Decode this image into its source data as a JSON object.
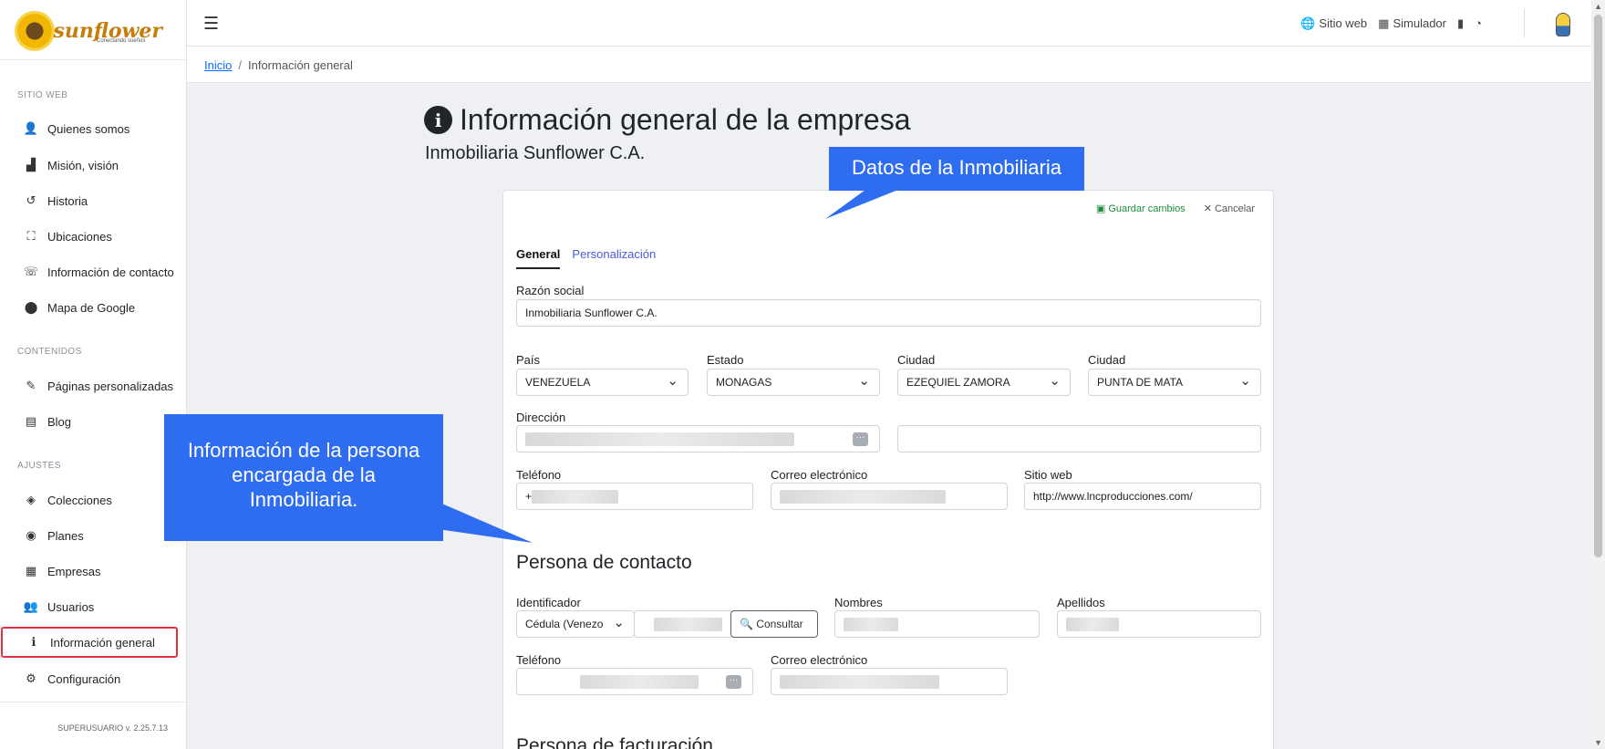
{
  "brand": {
    "name": "sunflower",
    "tagline": "Conectando sueños"
  },
  "sidebar": {
    "sections": [
      {
        "title": "SITIO WEB"
      },
      {
        "title": "CONTENIDOS"
      },
      {
        "title": "AJUSTES"
      }
    ],
    "items": [
      {
        "label": "Quienes somos",
        "icon": "user-icon"
      },
      {
        "label": "Misión, visión",
        "icon": "chart-icon"
      },
      {
        "label": "Historia",
        "icon": "history-icon"
      },
      {
        "label": "Ubicaciones",
        "icon": "map-location-icon"
      },
      {
        "label": "Información de contacto",
        "icon": "phone-icon"
      },
      {
        "label": "Mapa de Google",
        "icon": "map-pin-icon"
      },
      {
        "label": "Páginas personalizadas",
        "icon": "edit-page-icon"
      },
      {
        "label": "Blog",
        "icon": "newspaper-icon"
      },
      {
        "label": "Colecciones",
        "icon": "layers-icon"
      },
      {
        "label": "Planes",
        "icon": "user-badge-icon"
      },
      {
        "label": "Empresas",
        "icon": "buildings-icon"
      },
      {
        "label": "Usuarios",
        "icon": "users-icon"
      },
      {
        "label": "Información general",
        "icon": "info-icon"
      },
      {
        "label": "Configuración",
        "icon": "gear-icon"
      }
    ],
    "version": "SUPERUSUARIO v. 2.25.7.13"
  },
  "topbar": {
    "sitio_web": "Sitio web",
    "simulador": "Simulador"
  },
  "breadcrumb": {
    "home": "Inicio",
    "current": "Información general"
  },
  "page": {
    "title": "Información general de la empresa",
    "subtitle": "Inmobiliaria Sunflower C.A."
  },
  "card": {
    "save_label": "Guardar cambios",
    "cancel_label": "Cancelar",
    "tabs": [
      "General",
      "Personalización"
    ],
    "razon_social": {
      "label": "Razón social",
      "value": "Inmobiliaria Sunflower C.A."
    },
    "pais": {
      "label": "País",
      "value": "VENEZUELA"
    },
    "estado": {
      "label": "Estado",
      "value": "MONAGAS"
    },
    "ciudad1": {
      "label": "Ciudad",
      "value": "EZEQUIEL ZAMORA"
    },
    "ciudad2": {
      "label": "Ciudad",
      "value": "PUNTA DE MATA"
    },
    "direccion": {
      "label": "Dirección"
    },
    "telefono": {
      "label": "Teléfono",
      "prefix": "+"
    },
    "correo": {
      "label": "Correo electrónico"
    },
    "sitio_web": {
      "label": "Sitio web",
      "value": "http://www.lncproducciones.com/"
    },
    "contact_section": "Persona de contacto",
    "identificador": {
      "label": "Identificador",
      "value": "Cédula (Venezo"
    },
    "consultar_label": "Consultar",
    "nombres": {
      "label": "Nombres"
    },
    "apellidos": {
      "label": "Apellidos"
    },
    "contact_telefono": {
      "label": "Teléfono"
    },
    "contact_correo": {
      "label": "Correo electrónico"
    },
    "billing_section": "Persona de facturación"
  },
  "callouts": {
    "top": "Datos de la Inmobiliaria",
    "left": "Información de la persona encargada de la Inmobiliaria."
  }
}
